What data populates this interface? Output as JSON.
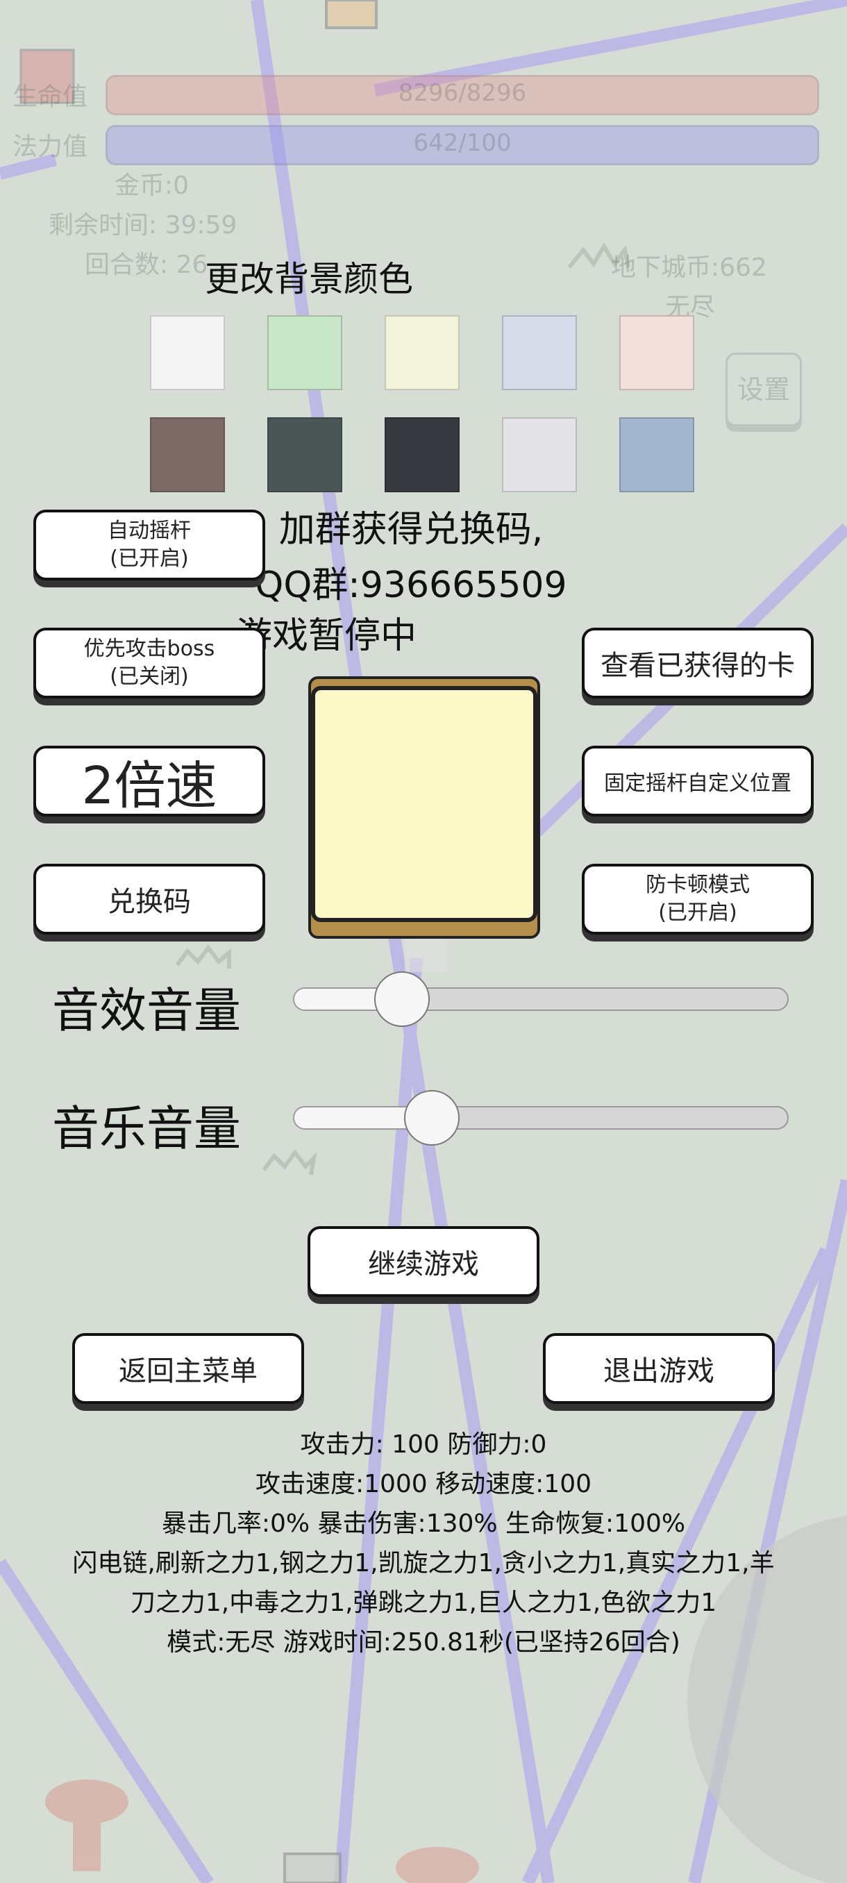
{
  "hud": {
    "hp_label": "生命值",
    "hp_value": "8296/8296",
    "mp_label": "法力值",
    "mp_value": "642/100",
    "gold": "金币:0",
    "time_left": "剩余时间: 39:59",
    "rounds": "回合数: 26",
    "dungeon_coins": "地下城币:662",
    "mode_endless": "无尽",
    "settings_label": "设置"
  },
  "bg_color": {
    "title": "更改背景颜色",
    "swatches": [
      "#f4f4f4",
      "#c8e6c8",
      "#f4f4dc",
      "#d6dce9",
      "#f2e0dc",
      "#7b6a66",
      "#4a5656",
      "#38393f",
      "#e4e4e8",
      "#a2b7cf"
    ]
  },
  "promo": {
    "line1": "加群获得兑换码,",
    "line2": "QQ群:936665509"
  },
  "paused_text": "游戏暂停中",
  "buttons": {
    "auto_stick_1": "自动摇杆",
    "auto_stick_2": "(已开启)",
    "boss_first_1": "优先攻击boss",
    "boss_first_2": "(已关闭)",
    "speed": "2倍速",
    "redeem": "兑换码",
    "view_cards": "查看已获得的卡",
    "fixed_stick": "固定摇杆自定义位置",
    "anti_lag_1": "防卡顿模式",
    "anti_lag_2": "(已开启)",
    "continue": "继续游戏",
    "main_menu": "返回主菜单",
    "exit": "退出游戏"
  },
  "sliders": {
    "sfx_label": "音效音量",
    "sfx_level": 0.22,
    "music_label": "音乐音量",
    "music_level": 0.28
  },
  "card_panel_color": "#fdf8c8",
  "card_border_color": "#b58f4c",
  "stats": {
    "line1": "攻击力: 100 防御力:0",
    "line2": "攻击速度:1000 移动速度:100",
    "line3": "暴击几率:0% 暴击伤害:130% 生命恢复:100%",
    "line4": "闪电链,刷新之力1,钢之力1,凯旋之力1,贪小之力1,真实之力1,羊",
    "line5": "刀之力1,中毒之力1,弹跳之力1,巨人之力1,色欲之力1",
    "line6": "模式:无尽 游戏时间:250.81秒(已坚持26回合)"
  }
}
